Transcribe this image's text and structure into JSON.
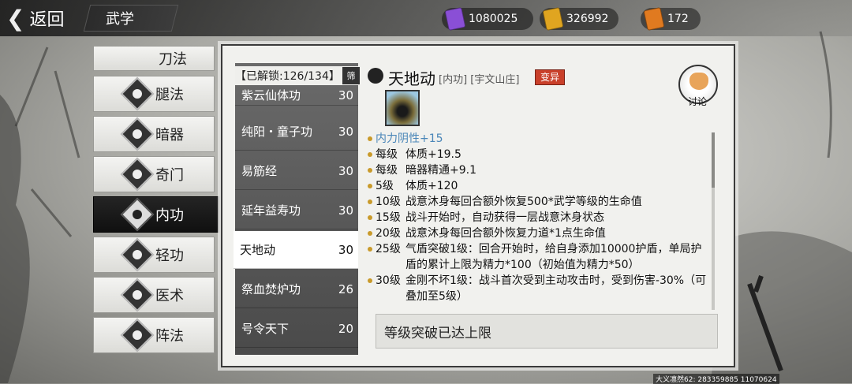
{
  "header": {
    "back_label": "返回",
    "title": "武学"
  },
  "currencies": [
    {
      "name": "purple-token-icon",
      "value": "1080025",
      "color": "#8a4fd6"
    },
    {
      "name": "gold-token-icon",
      "value": "326992",
      "color": "#e0a520"
    },
    {
      "name": "fire-token-icon",
      "value": "172",
      "color": "#e07a20"
    }
  ],
  "categories": [
    {
      "label": "刀法"
    },
    {
      "label": "腿法"
    },
    {
      "label": "暗器"
    },
    {
      "label": "奇门"
    },
    {
      "label": "内功"
    },
    {
      "label": "轻功"
    },
    {
      "label": "医术"
    },
    {
      "label": "阵法"
    }
  ],
  "list": {
    "unlock_text": "【已解锁:126/134】",
    "filter_label": "筛",
    "items": [
      {
        "name": "紫云仙体功",
        "level": "30"
      },
      {
        "name": "纯阳・童子功",
        "level": "30"
      },
      {
        "name": "易筋经",
        "level": "30"
      },
      {
        "name": "延年益寿功",
        "level": "30"
      },
      {
        "name": "天地动",
        "level": "30"
      },
      {
        "name": "祭血焚炉功",
        "level": "26"
      },
      {
        "name": "号令天下",
        "level": "20"
      }
    ]
  },
  "detail": {
    "name": "天地动",
    "meta": "[内功] [宇文山庄]",
    "mutation_label": "变异",
    "discuss_label": "讨论",
    "effects": [
      {
        "lv": "",
        "text": "内力阴性+15"
      },
      {
        "lv": "每级",
        "text": "体质+19.5"
      },
      {
        "lv": "每级",
        "text": "暗器精通+9.1"
      },
      {
        "lv": "5级",
        "text": "体质+120"
      },
      {
        "lv": "10级",
        "text": "战意沐身每回合额外恢复500*武学等级的生命值"
      },
      {
        "lv": "15级",
        "text": "战斗开始时，自动获得一层战意沐身状态"
      },
      {
        "lv": "20级",
        "text": "战意沐身每回合额外恢复力道*1点生命值"
      },
      {
        "lv": "25级",
        "text": "气盾突破1级：回合开始时，给自身添加10000护盾，单局护盾的累计上限为精力*100（初始值为精力*50）"
      },
      {
        "lv": "30级",
        "text": "金刚不坏1级：战斗首次受到主动攻击时，受到伤害-30%（可叠加至5级）"
      }
    ],
    "limit_text": "等级突破已达上限"
  },
  "watermark": "大义凛然62: 283359885 11070624"
}
